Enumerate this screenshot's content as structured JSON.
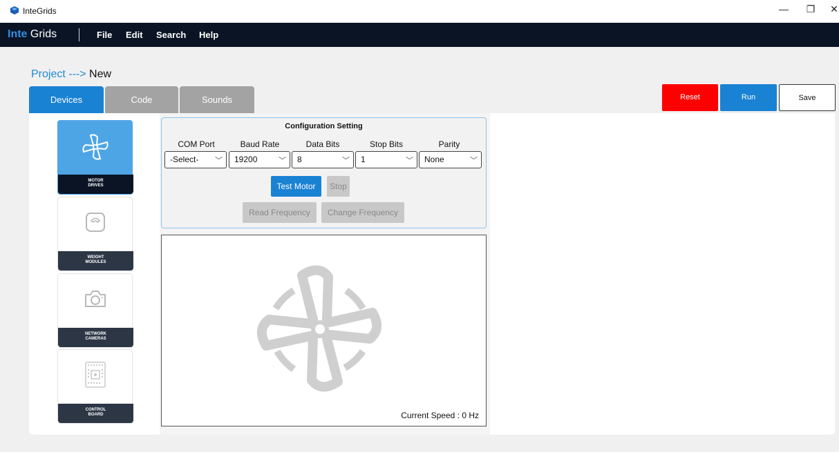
{
  "window": {
    "title": "InteGrids",
    "minimize_glyph": "—",
    "restore_glyph": "❐",
    "close_glyph": "✕"
  },
  "brand": {
    "accent": "Inte",
    "rest": " Grids"
  },
  "menu": [
    "File",
    "Edit",
    "Search",
    "Help"
  ],
  "breadcrumb": {
    "project": "Project",
    "arrow": " ---> ",
    "current": "New"
  },
  "tabs": [
    {
      "label": "Devices",
      "active": true
    },
    {
      "label": "Code",
      "active": false
    },
    {
      "label": "Sounds",
      "active": false
    }
  ],
  "actions": {
    "reset": "Reset",
    "run": "Run",
    "save": "Save"
  },
  "devices": [
    {
      "label_line1": "MOTOR",
      "label_line2": "DRIVES",
      "icon": "fan-icon",
      "selected": true
    },
    {
      "label_line1": "WEIGHT",
      "label_line2": "MODULES",
      "icon": "scale-icon",
      "selected": false
    },
    {
      "label_line1": "NETWORK",
      "label_line2": "CAMERAS",
      "icon": "camera-icon",
      "selected": false
    },
    {
      "label_line1": "CONTROL",
      "label_line2": "BOARD",
      "icon": "circuit-board-icon",
      "selected": false
    }
  ],
  "config": {
    "title": "Configuration Setting",
    "fields": [
      {
        "label": "COM Port",
        "value": "-Select-"
      },
      {
        "label": "Baud Rate",
        "value": "19200"
      },
      {
        "label": "Data Bits",
        "value": "8"
      },
      {
        "label": "Stop Bits",
        "value": "1"
      },
      {
        "label": "Parity",
        "value": "None"
      }
    ],
    "test_motor": "Test Motor",
    "stop": "Stop",
    "read_frequency": "Read Frequency",
    "change_frequency": "Change Frequency"
  },
  "motor": {
    "current_speed": "Current Speed : 0 Hz"
  },
  "colors": {
    "accent": "#1a82d3",
    "menubar": "#0a1425",
    "reset": "#ff0000",
    "disabled": "#c8c8c8"
  }
}
